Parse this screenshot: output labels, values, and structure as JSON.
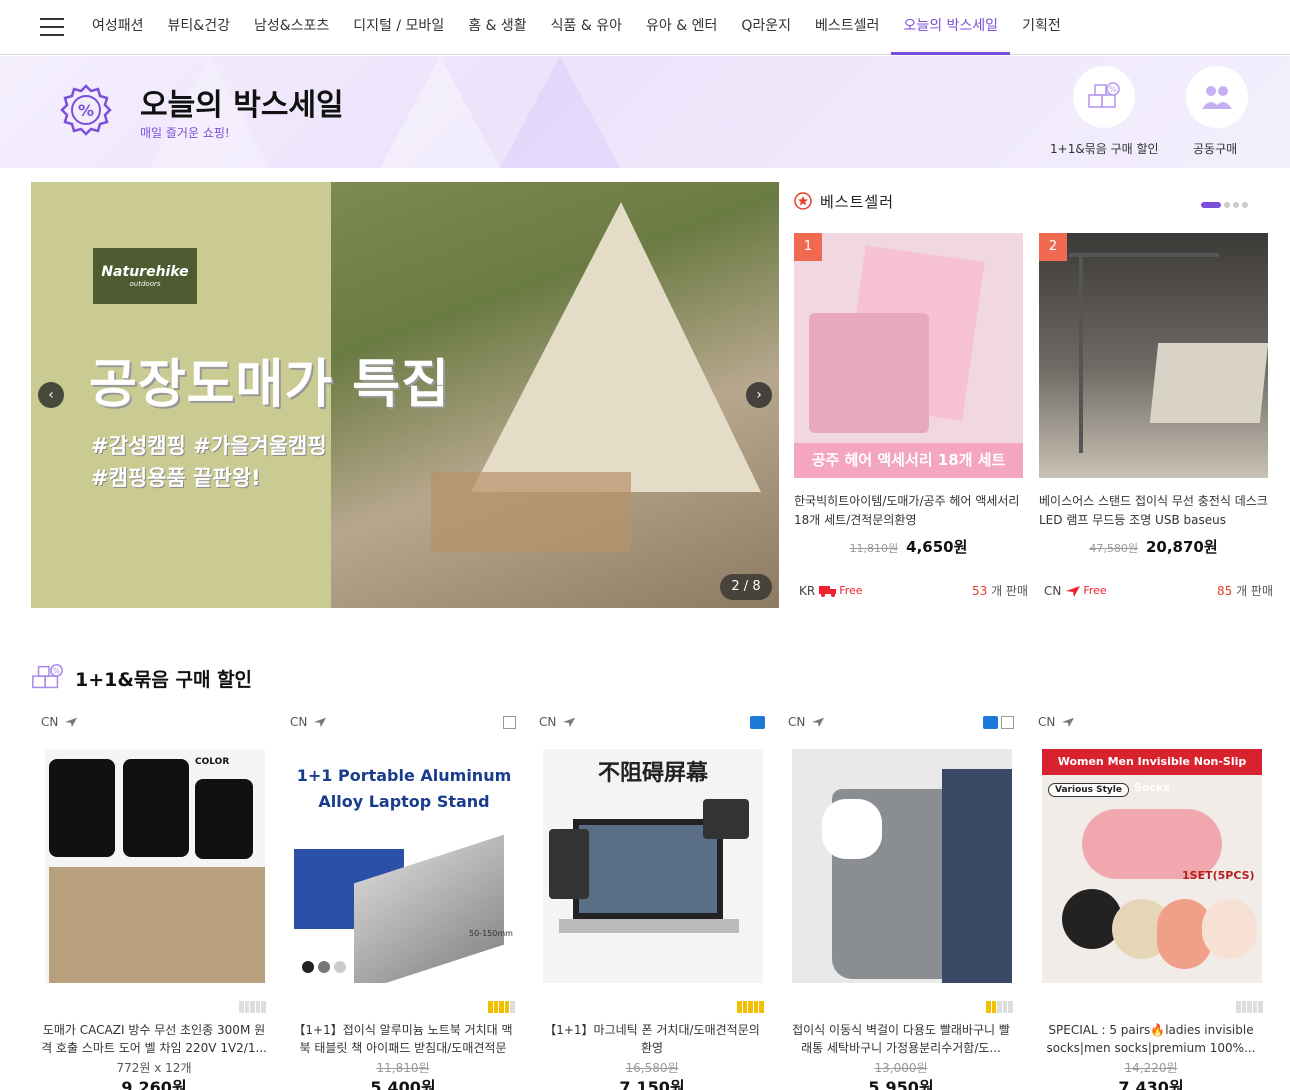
{
  "nav": {
    "items": [
      "여성패션",
      "뷰티&건강",
      "남성&스포츠",
      "디지털 / 모바일",
      "홈 & 생활",
      "식품 & 유아",
      "유아 & 엔터",
      "Q라운지",
      "베스트셀러",
      "오늘의 박스세일",
      "기획전"
    ],
    "active_index": 9
  },
  "hero": {
    "title": "오늘의 박스세일",
    "subtitle": "매일 즐거운 쇼핑!",
    "btn1_label": "1+1&묶음 구매 할인",
    "btn2_label": "공동구매"
  },
  "banner": {
    "brand": "Naturehike",
    "brand_sub": "outdoors",
    "title": "공장도매가 특집",
    "tag1": "#감성캠핑 #가을겨울캠핑",
    "tag2": "#캠핑용품 끝판왕!",
    "pager": "2 / 8",
    "prev": "‹",
    "next": "›"
  },
  "bestseller": {
    "title": "베스트셀러",
    "items": [
      {
        "rank": "1",
        "name": "한국빅히트아이템/도매가/공주 헤어 액세서리 18개 세트/견적문의환영",
        "old_price": "11,810원",
        "price": "4,650원",
        "origin": "KR",
        "shipping": "Free",
        "sold_count": "53",
        "sold_label": "개 판매",
        "img_caption": "공주 헤어 액세서리 18개 세트"
      },
      {
        "rank": "2",
        "name": "베이스어스 스탠드 접이식 무선 충전식 데스크 LED 램프 무드등 조명 USB baseus",
        "old_price": "47,580원",
        "price": "20,870원",
        "origin": "CN",
        "shipping": "Free",
        "sold_count": "85",
        "sold_label": "개 판매"
      }
    ]
  },
  "bundle": {
    "title": "1+1&묶음 구매 할인",
    "products": [
      {
        "origin": "CN",
        "video": false,
        "gallery": false,
        "level": 0,
        "name": "도매가 CACAZI 방수 무선 초인종 300M 원격 호출 스마트 도어 벨 차임 220V 1V2/1...",
        "sub": "772원 x 12개",
        "price": "9,260원",
        "img_text": "COLOR"
      },
      {
        "origin": "CN",
        "video": false,
        "gallery": true,
        "level": 4,
        "name": "【1+1】접이식 알루미늄 노트북 거치대 맥북 태블릿 책 아이패드 받침대/도매견적문의...",
        "sub": "11,810원",
        "price": "5,400원",
        "img_text": "1+1 Portable Aluminum Alloy Laptop Stand",
        "img_note": "50-150mm"
      },
      {
        "origin": "CN",
        "video": true,
        "gallery": false,
        "level": 4,
        "name": "【1+1】마그네틱 폰 거치대/도매견적문의환영",
        "sub": "16,580원",
        "price": "7,150원",
        "img_text": "不阻碍屏幕"
      },
      {
        "origin": "CN",
        "video": true,
        "gallery": true,
        "level": 2,
        "name": "접이식 이동식 벽걸이 다용도 빨래바구니 빨래통 세탁바구니 가정용분리수거함/도...",
        "sub": "13,000원",
        "price": "5,950원"
      },
      {
        "origin": "CN",
        "video": false,
        "gallery": false,
        "level": 0,
        "name": "SPECIAL : 5 pairs🔥ladies invisible socks|men socks|premium 100%...",
        "sub": "14,220원",
        "price": "7,430원",
        "img_text": "Women Men Invisible Non-Slip Socks",
        "img_note": "Various Style",
        "img_note2": "1SET(5PCS)"
      }
    ]
  }
}
